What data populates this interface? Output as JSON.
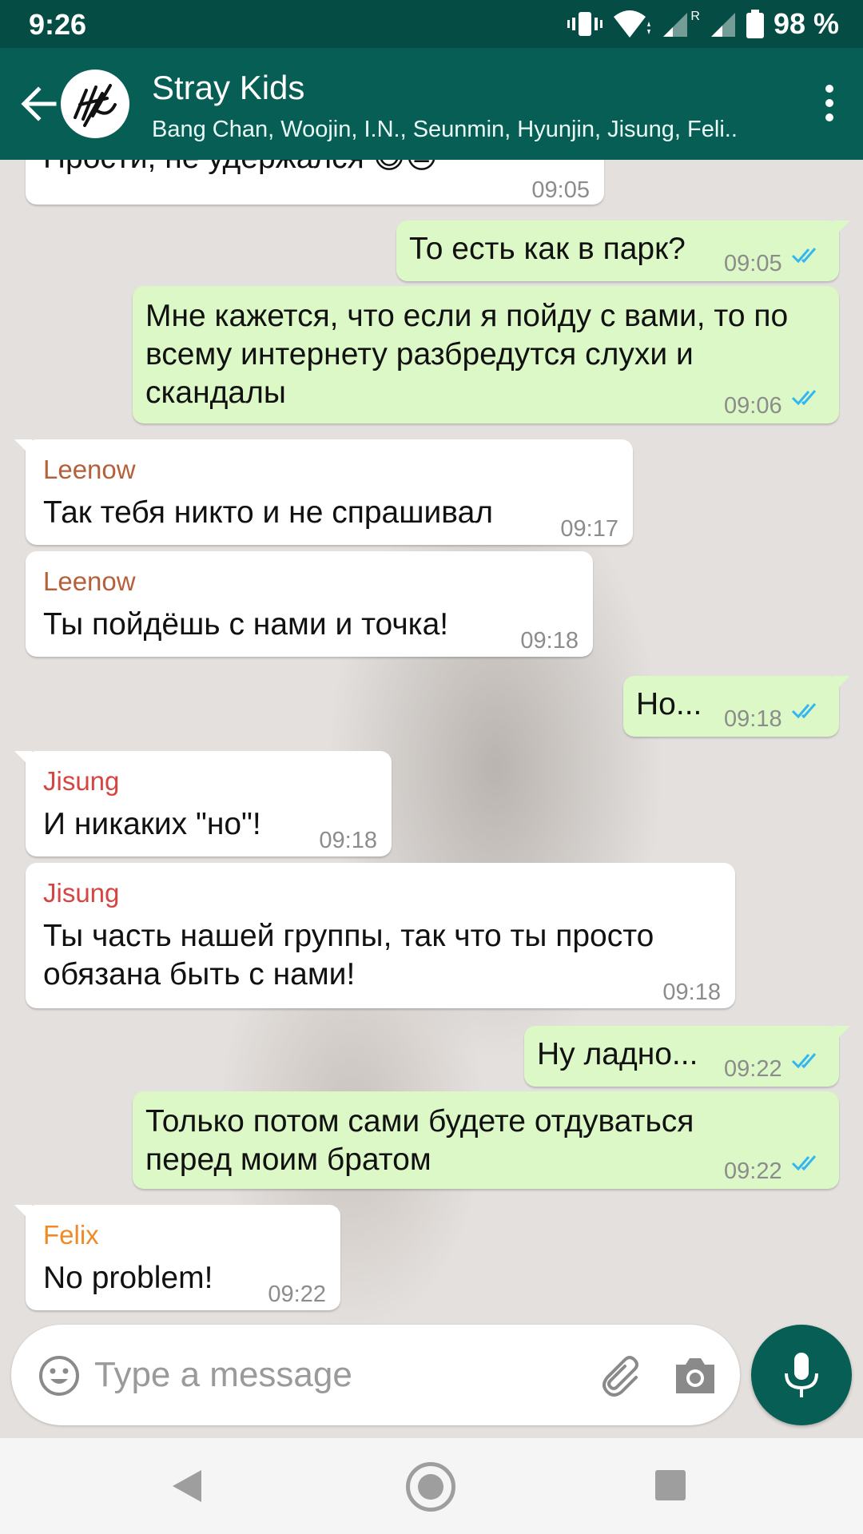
{
  "status_bar": {
    "time": "9:26",
    "battery": "98 %",
    "roaming": "R"
  },
  "header": {
    "title": "Stray Kids",
    "subtitle": "Bang Chan, Woojin, I.N., Seunmin, Hyunjin, Jisung, Feli.."
  },
  "colors": {
    "primary_dark": "#054d44",
    "primary": "#075e54",
    "outgoing_bubble": "#dcf8c6",
    "incoming_bubble": "#ffffff",
    "read_ticks": "#34b7f1",
    "leenow": "#b5603b",
    "jisung": "#d64541",
    "felix": "#f08a24"
  },
  "messages": [
    {
      "sender": "",
      "text": "Прости, не удержался 😅😓",
      "time": "09:05",
      "direction": "in"
    },
    {
      "text": "То есть как в парк?",
      "time": "09:05",
      "direction": "out"
    },
    {
      "text": "Мне кажется, что если я пойду с вами, то по всему интернету разбредутся слухи и скандалы",
      "time": "09:06",
      "direction": "out"
    },
    {
      "sender": "Leenow",
      "text": "Так тебя никто и не спрашивал",
      "time": "09:17",
      "direction": "in"
    },
    {
      "sender": "Leenow",
      "text": "Ты пойдёшь с нами и точка!",
      "time": "09:18",
      "direction": "in"
    },
    {
      "text": "Но...",
      "time": "09:18",
      "direction": "out"
    },
    {
      "sender": "Jisung",
      "text": "И никаких \"но\"!",
      "time": "09:18",
      "direction": "in"
    },
    {
      "sender": "Jisung",
      "text": "Ты часть нашей группы, так что ты просто обязана быть с нами!",
      "time": "09:18",
      "direction": "in"
    },
    {
      "text": "Ну ладно...",
      "time": "09:22",
      "direction": "out"
    },
    {
      "text": "Только потом сами будете отдуваться перед моим братом",
      "time": "09:22",
      "direction": "out"
    },
    {
      "sender": "Felix",
      "text": "No problem!",
      "time": "09:22",
      "direction": "in"
    }
  ],
  "composer": {
    "placeholder": "Type a message"
  },
  "icons": {
    "back": "arrow-left-icon",
    "menu": "more-vert-icon",
    "emoji": "smiley-icon",
    "attach": "paperclip-icon",
    "camera": "camera-icon",
    "mic": "microphone-icon"
  }
}
